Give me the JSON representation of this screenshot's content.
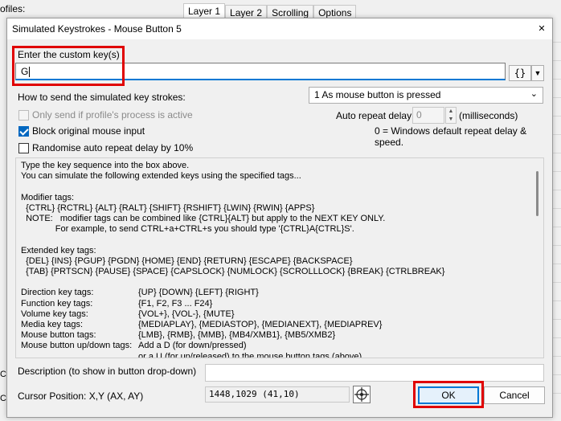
{
  "background": {
    "profiles_label": "ofiles:",
    "tabs": [
      "Layer 1",
      "Layer 2",
      "Scrolling",
      "Options"
    ],
    "left_labels": [
      "Co",
      "Co"
    ]
  },
  "dialog": {
    "title": "Simulated Keystrokes - Mouse Button 5",
    "close_glyph": "✕",
    "enter_label": "Enter the custom key(s)",
    "key_value": "G",
    "tag_button": "{}",
    "tag_dropdown": "▼",
    "how_label": "How to send the simulated key strokes:",
    "how_value": "1 As mouse button is pressed",
    "only_send_label": "Only send if profile's process is active",
    "block_label": "Block original mouse input",
    "randomise_label": "Randomise auto repeat delay by 10%",
    "auto_repeat_label": "Auto repeat delay",
    "auto_repeat_value": "0",
    "auto_repeat_unit": "(milliseconds)",
    "auto_repeat_note": "0 = Windows default repeat delay & speed.",
    "help": {
      "intro1": "Type the key sequence into the box above.",
      "intro2": "You can simulate the following extended keys using the specified tags...",
      "mod_title": "Modifier tags:",
      "mod_tags": "  {CTRL} {RCTRL} {ALT} {RALT} {SHIFT} {RSHIFT} {LWIN} {RWIN} {APPS}",
      "note1": "  NOTE:   modifier tags can be combined like {CTRL}{ALT} but apply to the NEXT KEY ONLY.",
      "note2": "              For example, to send CTRL+a+CTRL+s you should type '{CTRL}A{CTRL}S'.",
      "ext_title": "Extended key tags:",
      "ext1": "  {DEL} {INS} {PGUP} {PGDN} {HOME} {END} {RETURN} {ESCAPE} {BACKSPACE}",
      "ext2": "  {TAB} {PRTSCN} {PAUSE} {SPACE} {CAPSLOCK} {NUMLOCK} {SCROLLLOCK} {BREAK} {CTRLBREAK}",
      "rows": [
        {
          "k": "Direction key tags:",
          "v": "{UP} {DOWN} {LEFT} {RIGHT}"
        },
        {
          "k": "Function key tags:",
          "v": "{F1, F2, F3 ... F24}"
        },
        {
          "k": "Volume key tags:",
          "v": "{VOL+}, {VOL-}, {MUTE}"
        },
        {
          "k": "Media key tags:",
          "v": "{MEDIAPLAY}, {MEDIASTOP}, {MEDIANEXT}, {MEDIAPREV}"
        },
        {
          "k": "Mouse button tags:",
          "v": "{LMB}, {RMB}, {MMB}, {MB4/XMB1}, {MB5/XMB2}"
        },
        {
          "k": "Mouse button up/down tags:",
          "v": "Add a D (for down/pressed)"
        },
        {
          "k": "",
          "v": "or a U (for up/released) to the mouse button tags (above)"
        }
      ]
    },
    "desc_label": "Description (to show in button drop-down)",
    "desc_value": "",
    "cursor_label": "Cursor Position: X,Y (AX, AY)",
    "cursor_value": "1448,1029 (41,10)",
    "ok_label": "OK",
    "cancel_label": "Cancel",
    "colors": {
      "accent": "#0078d4",
      "highlight": "#e00000"
    }
  }
}
